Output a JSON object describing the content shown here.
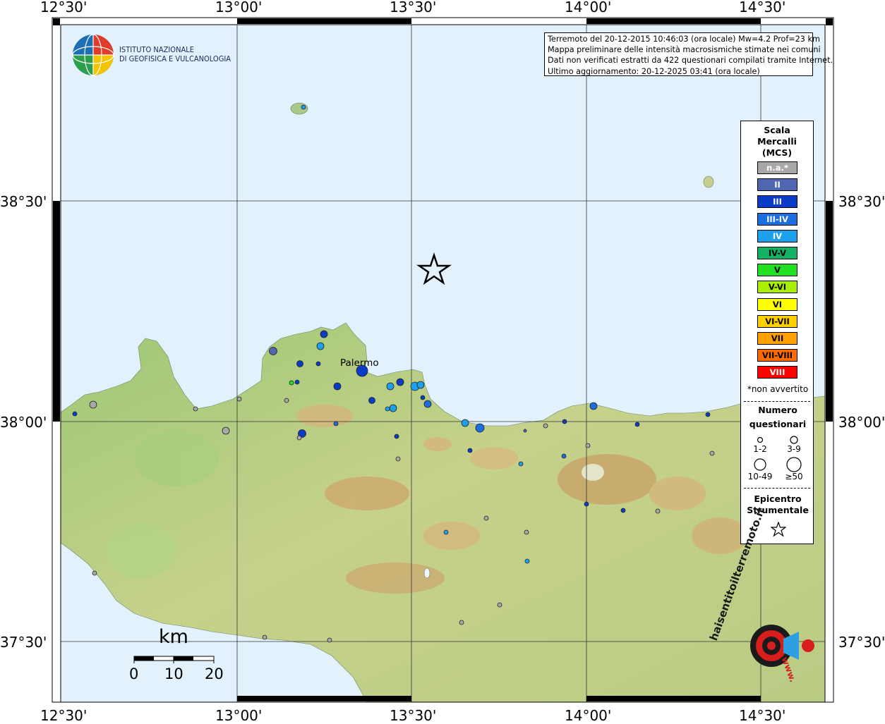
{
  "axes": {
    "lon_ticks": [
      "12°30'",
      "13°00'",
      "13°30'",
      "14°00'",
      "14°30'"
    ],
    "lat_ticks": [
      "38°30'",
      "38°00'",
      "37°30'"
    ]
  },
  "logo": {
    "line1": "ISTITUTO NAZIONALE",
    "line2": "DI GEOFISICA E VULCANOLOGIA"
  },
  "info": {
    "line1": "Terremoto del 20-12-2015 10:46:03 (ora locale) Mw=4.2 Prof=23 km",
    "line2": "Mappa preliminare delle intensità macrosismiche stimate nei comuni",
    "line3": "Dati non verificati estratti da 422 questionari compilati tramite Internet.",
    "line4": "Ultimo aggiornamento: 20-12-2025 03:41 (ora locale)"
  },
  "legend": {
    "title1": "Scala",
    "title2": "Mercalli",
    "title3": "(MCS)",
    "classes": [
      {
        "label": "n.a.*",
        "color": "#a8a8a8",
        "text": "#ffffff"
      },
      {
        "label": "II",
        "color": "#4f67b0",
        "text": "#ffffff"
      },
      {
        "label": "III",
        "color": "#0a3cc8",
        "text": "#ffffff"
      },
      {
        "label": "III-IV",
        "color": "#1c6ee0",
        "text": "#ffffff"
      },
      {
        "label": "IV",
        "color": "#1ea0ee",
        "text": "#ffffff"
      },
      {
        "label": "IV-V",
        "color": "#14b064",
        "text": "#000000"
      },
      {
        "label": "V",
        "color": "#22e022",
        "text": "#000000"
      },
      {
        "label": "V-VI",
        "color": "#a8f000",
        "text": "#000000"
      },
      {
        "label": "VI",
        "color": "#ffff00",
        "text": "#000000"
      },
      {
        "label": "VI-VII",
        "color": "#ffd000",
        "text": "#000000"
      },
      {
        "label": "VII",
        "color": "#ffa000",
        "text": "#000000"
      },
      {
        "label": "VII-VIII",
        "color": "#ff6a00",
        "text": "#000000"
      },
      {
        "label": "VIII",
        "color": "#ff0000",
        "text": "#ffffff"
      }
    ],
    "not_felt_note": "*non avvertito",
    "count_title1": "Numero",
    "count_title2": "questionari",
    "count_sizes": [
      "1-2",
      "3-9",
      "10-49",
      "≥50"
    ],
    "epicenter_title1": "Epicentro",
    "epicenter_title2": "Strumentale"
  },
  "places": {
    "palermo": "Palermo"
  },
  "scalebar": {
    "unit": "km",
    "labels": [
      "0",
      "10",
      "20"
    ]
  },
  "brand": {
    "text": "haisentitoilterremoto.it",
    "www": "www."
  },
  "colors": {
    "sea": "#e2f1fc",
    "land_low": "#8fbf6b",
    "land_mid": "#c9d48f",
    "land_high": "#d2b07a",
    "grid": "#333333"
  }
}
